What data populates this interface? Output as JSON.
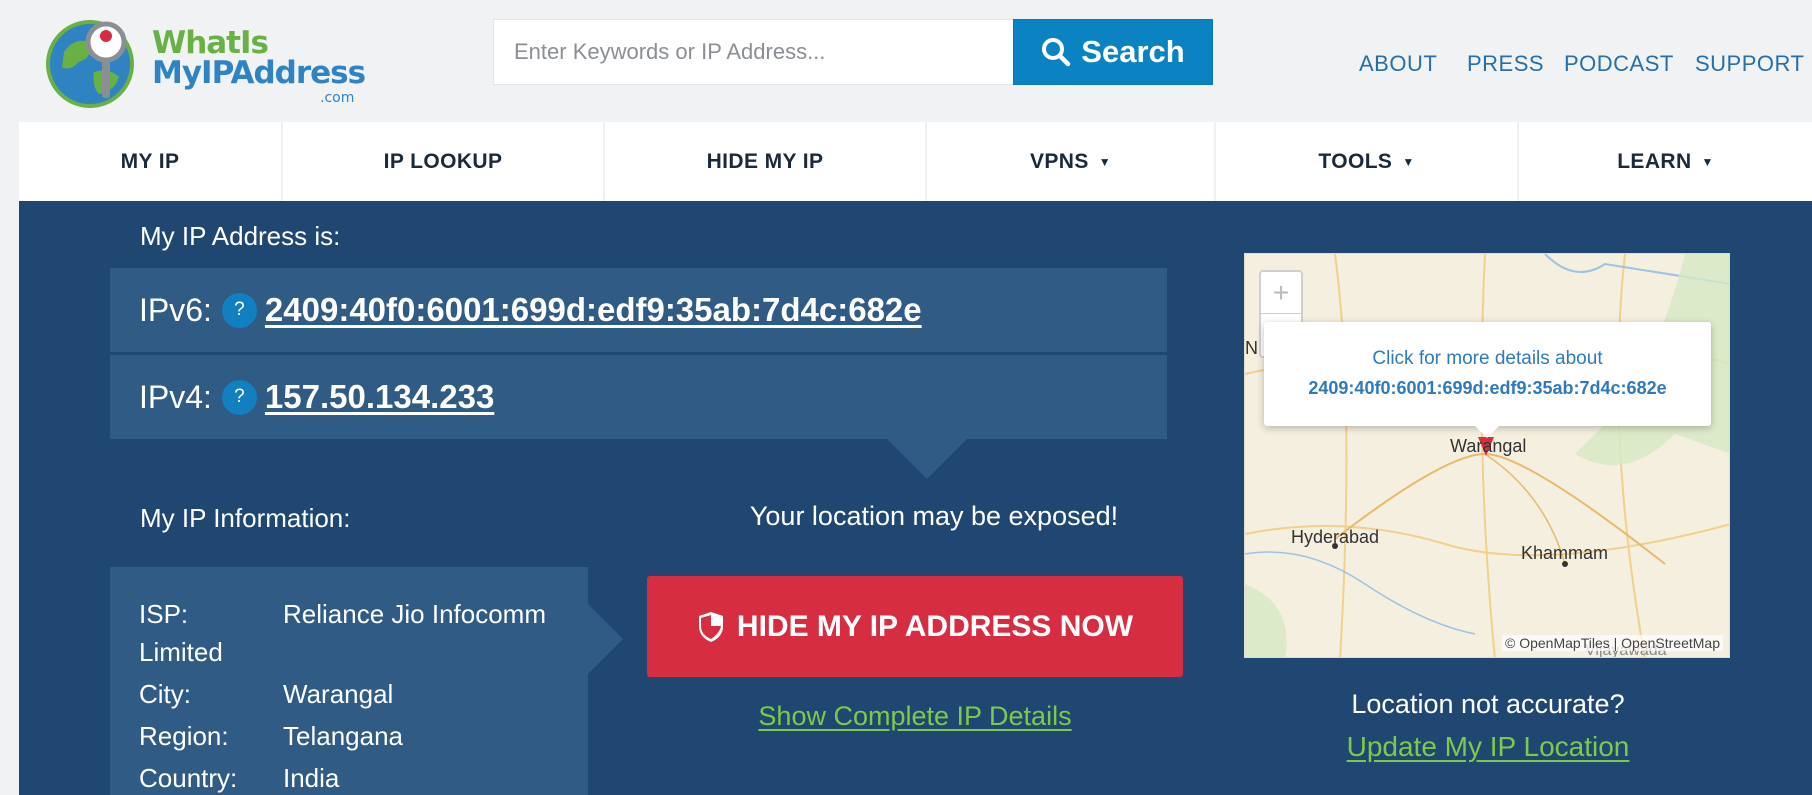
{
  "header": {
    "logo_line1": "WhatIs",
    "logo_line2": "MyIPAddress",
    "logo_suffix": ".com",
    "search_placeholder": "Enter Keywords or IP Address...",
    "search_button": "Search",
    "links": [
      "ABOUT",
      "PRESS",
      "PODCAST",
      "SUPPORT"
    ]
  },
  "nav": {
    "items": [
      {
        "label": "MY IP",
        "dropdown": false
      },
      {
        "label": "IP LOOKUP",
        "dropdown": false
      },
      {
        "label": "HIDE MY IP",
        "dropdown": false
      },
      {
        "label": "VPNS",
        "dropdown": true
      },
      {
        "label": "TOOLS",
        "dropdown": true
      },
      {
        "label": "LEARN",
        "dropdown": true
      }
    ],
    "caret": "▼"
  },
  "main": {
    "ip_heading": "My IP Address is:",
    "ipv6_label": "IPv6:",
    "ipv6_value": "2409:40f0:6001:699d:edf9:35ab:7d4c:682e",
    "ipv4_label": "IPv4:",
    "ipv4_value": "157.50.134.233",
    "help_glyph": "?",
    "info_heading": "My IP Information:",
    "info": {
      "isp_key": "ISP:",
      "isp_val": "Reliance Jio Infocomm",
      "isp_val_cont": "Limited",
      "city_key": "City:",
      "city_val": "Warangal",
      "region_key": "Region:",
      "region_val": "Telangana",
      "country_key": "Country:",
      "country_val": "India"
    },
    "exposed_text": "Your location may be exposed!",
    "hide_button": "HIDE MY IP ADDRESS NOW",
    "details_link": "Show Complete IP Details",
    "map": {
      "zoom_in": "+",
      "zoom_out": "−",
      "popup_line1": "Click for more details about",
      "popup_line2": "2409:40f0:6001:699d:edf9:35ab:7d4c:682e",
      "cities": [
        "Warangal",
        "Hyderabad",
        "Khammam",
        "Niz",
        "Vijayawada"
      ],
      "attribution": "© OpenMapTiles | OpenStreetMap"
    },
    "location_question": "Location not accurate?",
    "update_link": "Update My IP Location"
  },
  "colors": {
    "brand_green": "#69b144",
    "brand_blue": "#2f83c3",
    "nav_dark": "#1f4772",
    "panel": "#2f5b85",
    "cta_red": "#d62d41",
    "link_green": "#7dc94b"
  }
}
